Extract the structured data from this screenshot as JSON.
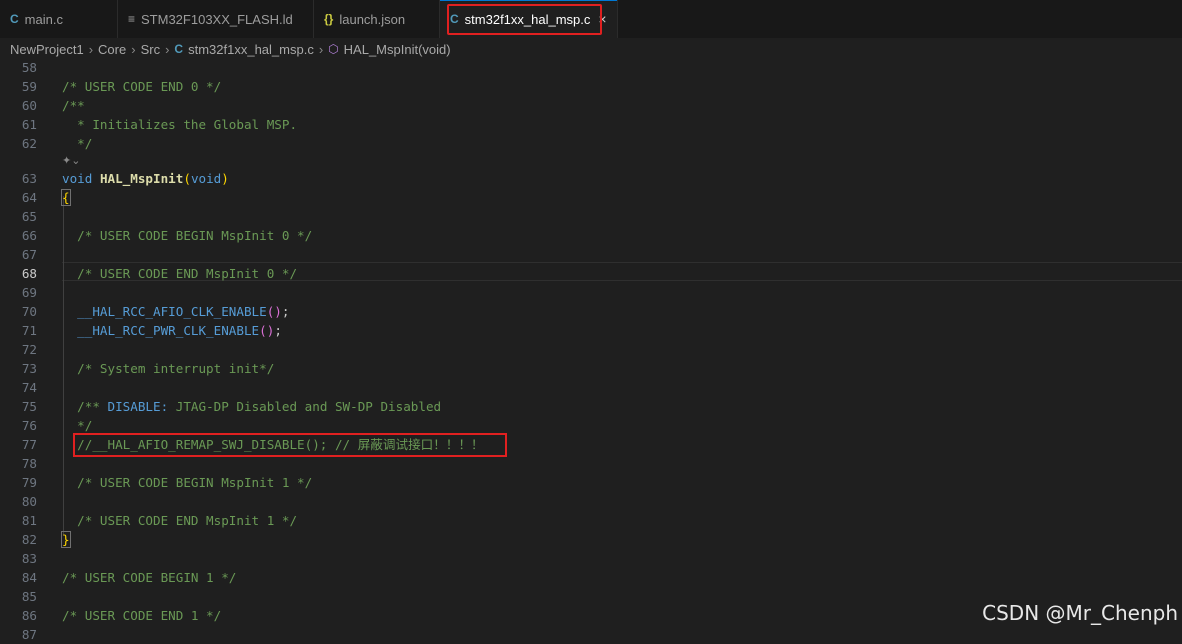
{
  "tabs": [
    {
      "icon": "C",
      "label": "main.c"
    },
    {
      "icon": "≡",
      "label": "STM32F103XX_FLASH.ld"
    },
    {
      "icon": "{}",
      "label": "launch.json"
    },
    {
      "icon": "C",
      "label": "stm32f1xx_hal_msp.c",
      "active": true,
      "close": "×"
    }
  ],
  "breadcrumb": {
    "items": [
      "NewProject1",
      "Core",
      "Src",
      "stm32f1xx_hal_msp.c",
      "HAL_MspInit(void)"
    ],
    "separator": "›",
    "file_icon": "C",
    "symbol_icon": "⬡"
  },
  "lines": {
    "l58": "58",
    "l59": "59",
    "l60": "60",
    "l61": "61",
    "l62": "62",
    "l63": "63",
    "l64": "64",
    "l65": "65",
    "l66": "66",
    "l67": "67",
    "l68": "68",
    "l69": "69",
    "l70": "70",
    "l71": "71",
    "l72": "72",
    "l73": "73",
    "l74": "74",
    "l75": "75",
    "l76": "76",
    "l77": "77",
    "l78": "78",
    "l79": "79",
    "l80": "80",
    "l81": "81",
    "l82": "82",
    "l83": "83",
    "l84": "84",
    "l85": "85",
    "l86": "86",
    "l87": "87"
  },
  "code": {
    "c59": "/* USER CODE END 0 */",
    "c60": "/**",
    "c61": "  * Initializes the Global MSP.",
    "c62": "  */",
    "codelens": "✦⌄",
    "c63_kw": "void",
    "c63_fn": "HAL_MspInit",
    "c63_open": "(",
    "c63_arg": "void",
    "c63_close": ")",
    "c64": "{",
    "c66": "  /* USER CODE BEGIN MspInit 0 */",
    "c68": "  /* USER CODE END MspInit 0 */",
    "c70_m": "  __HAL_RCC_AFIO_CLK_ENABLE",
    "c70_p": "()",
    "c70_s": ";",
    "c71_m": "  __HAL_RCC_PWR_CLK_ENABLE",
    "c71_p": "()",
    "c71_s": ";",
    "c73": "  /* System interrupt init*/",
    "c75_a": "  /** ",
    "c75_b": "DISABLE:",
    "c75_c": " JTAG-DP Disabled and SW-DP Disabled",
    "c76": "  */",
    "c77_a": "  //__HAL_AFIO_REMAP_SWJ_DISABLE(); // ",
    "c77_b": "屏蔽调试接口！！！！",
    "c79": "  /* USER CODE BEGIN MspInit 1 */",
    "c81": "  /* USER CODE END MspInit 1 */",
    "c82": "}",
    "c84": "/* USER CODE BEGIN 1 */",
    "c86": "/* USER CODE END 1 */"
  },
  "watermark": "CSDN @Mr_Chenph"
}
